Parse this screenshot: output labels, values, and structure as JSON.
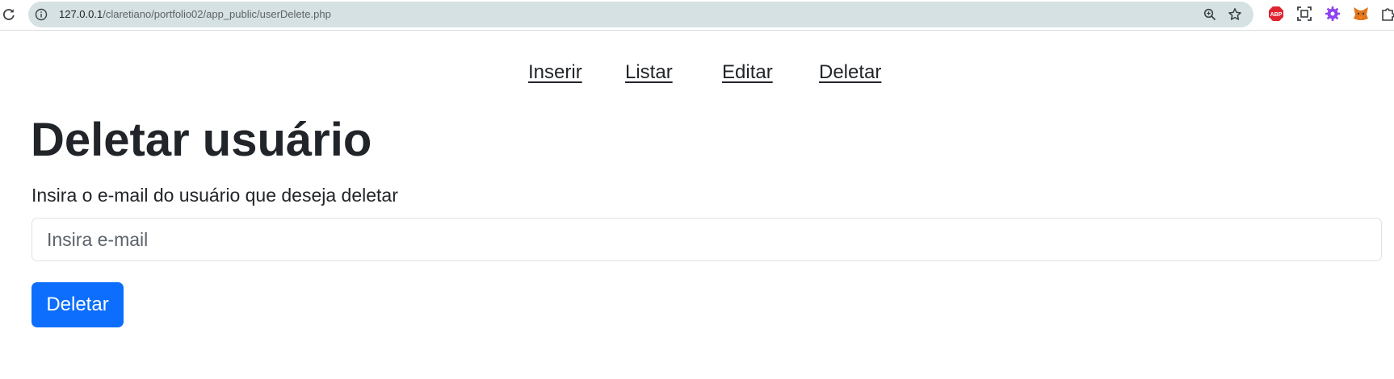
{
  "browser": {
    "url_host": "127.0.0.1",
    "url_path": "/claretiano/portfolio02/app_public/userDelete.php",
    "icons": [
      "reload-icon",
      "site-info-icon",
      "zoom-icon",
      "bookmark-star-icon",
      "adblock-plus-icon",
      "screenshot-icon",
      "gear-extension-icon",
      "metamask-fox-icon",
      "extensions-puzzle-icon"
    ],
    "abp_label": "ABP"
  },
  "nav": {
    "items": [
      {
        "label": "Inserir"
      },
      {
        "label": "Listar"
      },
      {
        "label": "Editar"
      },
      {
        "label": "Deletar"
      }
    ]
  },
  "main": {
    "title": "Deletar usuário",
    "instruction": "Insira o e-mail do usuário que deseja deletar",
    "email_placeholder": "Insira e-mail",
    "email_value": "",
    "submit_label": "Deletar"
  },
  "colors": {
    "primary": "#0d6efd",
    "text": "#212529",
    "omnibox": "#d5e1e3"
  }
}
